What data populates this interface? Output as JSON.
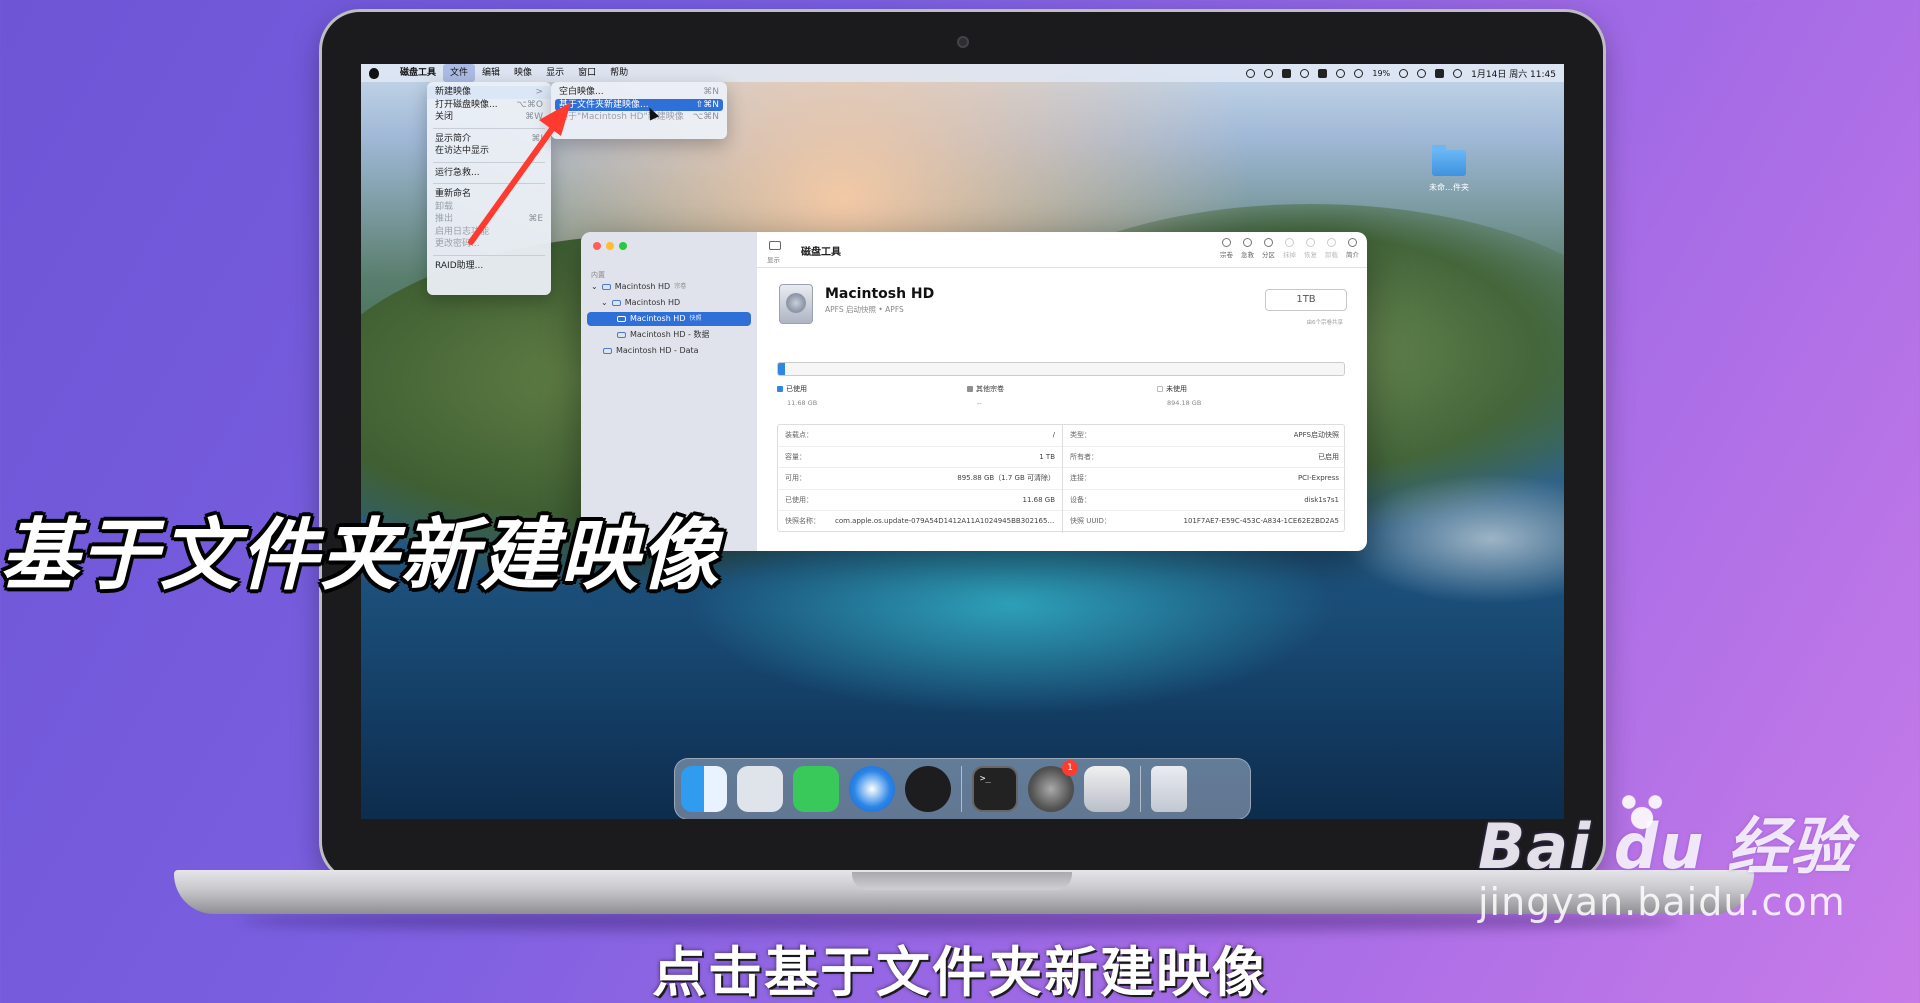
{
  "menubar": {
    "app": "磁盘工具",
    "menus": [
      "文件",
      "编辑",
      "映像",
      "显示",
      "窗口",
      "帮助"
    ],
    "battery": "19%",
    "clock": "1月14日 周六 11:45"
  },
  "file_menu": {
    "items": [
      {
        "label": "新建映像",
        "shortcut": ">"
      },
      {
        "label": "打开磁盘映像...",
        "shortcut": "⌥⌘O"
      },
      {
        "label": "关闭",
        "shortcut": "⌘W"
      },
      {
        "label": "显示简介",
        "shortcut": "⌘I"
      },
      {
        "label": "在访达中显示",
        "shortcut": ""
      },
      {
        "label": "运行急救...",
        "shortcut": ""
      },
      {
        "label": "重新命名",
        "shortcut": ""
      },
      {
        "label": "卸载",
        "shortcut": ""
      },
      {
        "label": "推出",
        "shortcut": "⌘E"
      },
      {
        "label": "启用日志功能",
        "shortcut": ""
      },
      {
        "label": "更改密码...",
        "shortcut": ""
      },
      {
        "label": "RAID助理...",
        "shortcut": ""
      }
    ]
  },
  "submenu": {
    "items": [
      {
        "label": "空白映像...",
        "shortcut": "⌘N"
      },
      {
        "label": "基于文件夹新建映像...",
        "shortcut": "⇧⌘N"
      },
      {
        "label": "基于\"Macintosh HD\"新建映像",
        "shortcut": "⌥⌘N"
      }
    ]
  },
  "window": {
    "title": "磁盘工具",
    "show_label": "显示",
    "sidebar": {
      "section": "内置",
      "items": [
        {
          "label": "Macintosh HD",
          "tag": "宗卷"
        },
        {
          "label": "Macintosh HD",
          "tag": ""
        },
        {
          "label": "Macintosh HD",
          "tag": "快照"
        },
        {
          "label": "Macintosh HD - 数据",
          "tag": ""
        },
        {
          "label": "Macintosh HD - Data",
          "tag": ""
        }
      ]
    },
    "toolbar": [
      "宗卷",
      "急救",
      "分区",
      "抹掉",
      "恢复",
      "卸载",
      "简介"
    ],
    "disk": {
      "name": "Macintosh HD",
      "subtitle": "APFS 启动快照 • APFS",
      "capacity": "1TB",
      "capacity_note": "由6个宗卷共享"
    },
    "usage": {
      "used_fraction": 0.012,
      "legend": [
        {
          "label": "已使用",
          "value": "11.68 GB",
          "color": "#2f88e0"
        },
        {
          "label": "其他宗卷",
          "value": "--",
          "color": "#8e8e93"
        },
        {
          "label": "未使用",
          "value": "894.18 GB",
          "color": "#ffffff"
        }
      ]
    },
    "info_left": [
      {
        "k": "装载点：",
        "v": "/"
      },
      {
        "k": "容量：",
        "v": "1 TB"
      },
      {
        "k": "可用：",
        "v": "895.88 GB（1.7 GB 可清除）"
      },
      {
        "k": "已使用：",
        "v": "11.68 GB"
      },
      {
        "k": "快照名称：",
        "v": "com.apple.os.update-079A54D1412A11A1024945BB3021653F5..."
      }
    ],
    "info_right": [
      {
        "k": "类型：",
        "v": "APFS启动快照"
      },
      {
        "k": "所有者：",
        "v": "已启用"
      },
      {
        "k": "连接：",
        "v": "PCI-Express"
      },
      {
        "k": "设备：",
        "v": "disk1s7s1"
      },
      {
        "k": "快照 UUID：",
        "v": "101F7AE7-E59C-453C-A834-1CE62E2BD2A5"
      }
    ]
  },
  "desktop_folder": "未命…件夹",
  "dock": {
    "apps": [
      "finder-icon",
      "launchpad-icon",
      "messages-icon",
      "safari-icon",
      "quicktime-icon",
      "terminal-icon",
      "system-preferences-icon",
      "disk-utility-icon",
      "trash-icon"
    ],
    "pref_badge": "1"
  },
  "overlay_title": "基于文件夹新建映像",
  "caption": "点击基于文件夹新建映像",
  "watermark": {
    "logo": "Bai du 经验",
    "sub": "jingyan.baidu.com"
  }
}
